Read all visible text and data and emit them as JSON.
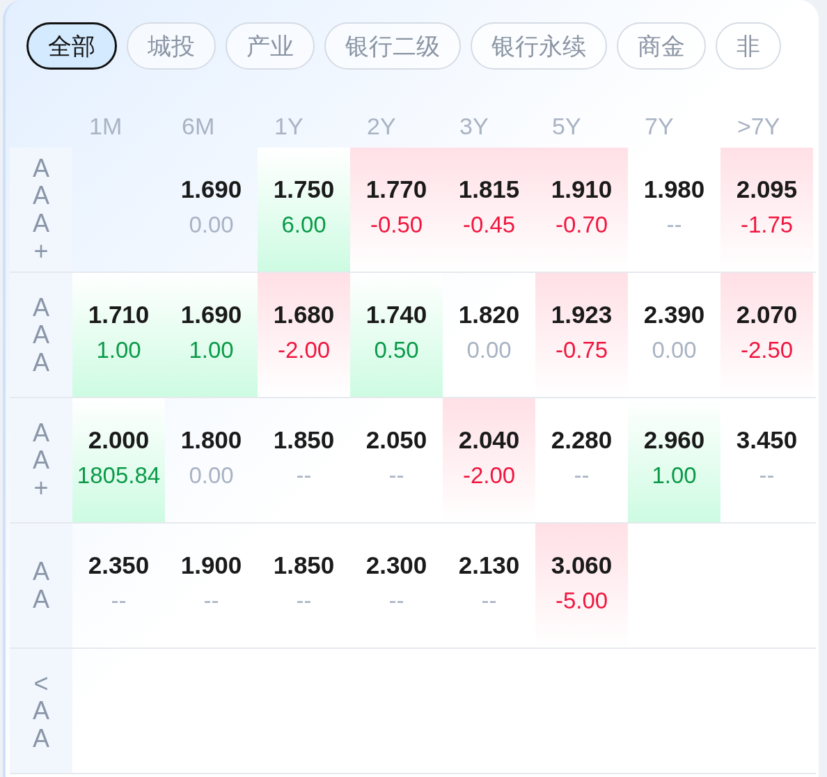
{
  "tabs": [
    {
      "label": "全部",
      "selected": true
    },
    {
      "label": "城投",
      "selected": false
    },
    {
      "label": "产业",
      "selected": false
    },
    {
      "label": "银行二级",
      "selected": false
    },
    {
      "label": "银行永续",
      "selected": false
    },
    {
      "label": "商金",
      "selected": false
    },
    {
      "label": "非",
      "selected": false
    }
  ],
  "columns": [
    "1M",
    "6M",
    "1Y",
    "2Y",
    "3Y",
    "5Y",
    "7Y",
    ">7Y"
  ],
  "rows": [
    {
      "label": "AAA+",
      "cells": [
        {
          "kind": "empty"
        },
        {
          "kind": "flat",
          "value": "1.690",
          "change": "0.00"
        },
        {
          "kind": "up",
          "value": "1.750",
          "change": "6.00"
        },
        {
          "kind": "down",
          "value": "1.770",
          "change": "-0.50"
        },
        {
          "kind": "down",
          "value": "1.815",
          "change": "-0.45"
        },
        {
          "kind": "down",
          "value": "1.910",
          "change": "-0.70"
        },
        {
          "kind": "flat",
          "value": "1.980",
          "change": "--"
        },
        {
          "kind": "down",
          "value": "2.095",
          "change": "-1.75"
        }
      ]
    },
    {
      "label": "AAA",
      "cells": [
        {
          "kind": "up",
          "value": "1.710",
          "change": "1.00"
        },
        {
          "kind": "up",
          "value": "1.690",
          "change": "1.00"
        },
        {
          "kind": "down",
          "value": "1.680",
          "change": "-2.00"
        },
        {
          "kind": "up",
          "value": "1.740",
          "change": "0.50"
        },
        {
          "kind": "flat",
          "value": "1.820",
          "change": "0.00"
        },
        {
          "kind": "down",
          "value": "1.923",
          "change": "-0.75"
        },
        {
          "kind": "flat",
          "value": "2.390",
          "change": "0.00"
        },
        {
          "kind": "down",
          "value": "2.070",
          "change": "-2.50"
        }
      ]
    },
    {
      "label": "AA+",
      "cells": [
        {
          "kind": "up",
          "value": "2.000",
          "change": "1805.84"
        },
        {
          "kind": "flat",
          "value": "1.800",
          "change": "0.00"
        },
        {
          "kind": "flat",
          "value": "1.850",
          "change": "--"
        },
        {
          "kind": "flat",
          "value": "2.050",
          "change": "--"
        },
        {
          "kind": "down",
          "value": "2.040",
          "change": "-2.00"
        },
        {
          "kind": "flat",
          "value": "2.280",
          "change": "--"
        },
        {
          "kind": "up",
          "value": "2.960",
          "change": "1.00"
        },
        {
          "kind": "flat",
          "value": "3.450",
          "change": "--"
        }
      ]
    },
    {
      "label": "AA",
      "cells": [
        {
          "kind": "flat",
          "value": "2.350",
          "change": "--"
        },
        {
          "kind": "flat",
          "value": "1.900",
          "change": "--"
        },
        {
          "kind": "flat",
          "value": "1.850",
          "change": "--"
        },
        {
          "kind": "flat",
          "value": "2.300",
          "change": "--"
        },
        {
          "kind": "flat",
          "value": "2.130",
          "change": "--"
        },
        {
          "kind": "down",
          "value": "3.060",
          "change": "-5.00"
        },
        {
          "kind": "empty"
        },
        {
          "kind": "empty"
        }
      ]
    },
    {
      "label": "<AA",
      "cells": [
        {
          "kind": "empty"
        },
        {
          "kind": "empty"
        },
        {
          "kind": "empty"
        },
        {
          "kind": "empty"
        },
        {
          "kind": "empty"
        },
        {
          "kind": "empty"
        },
        {
          "kind": "empty"
        },
        {
          "kind": "empty"
        }
      ]
    }
  ]
}
